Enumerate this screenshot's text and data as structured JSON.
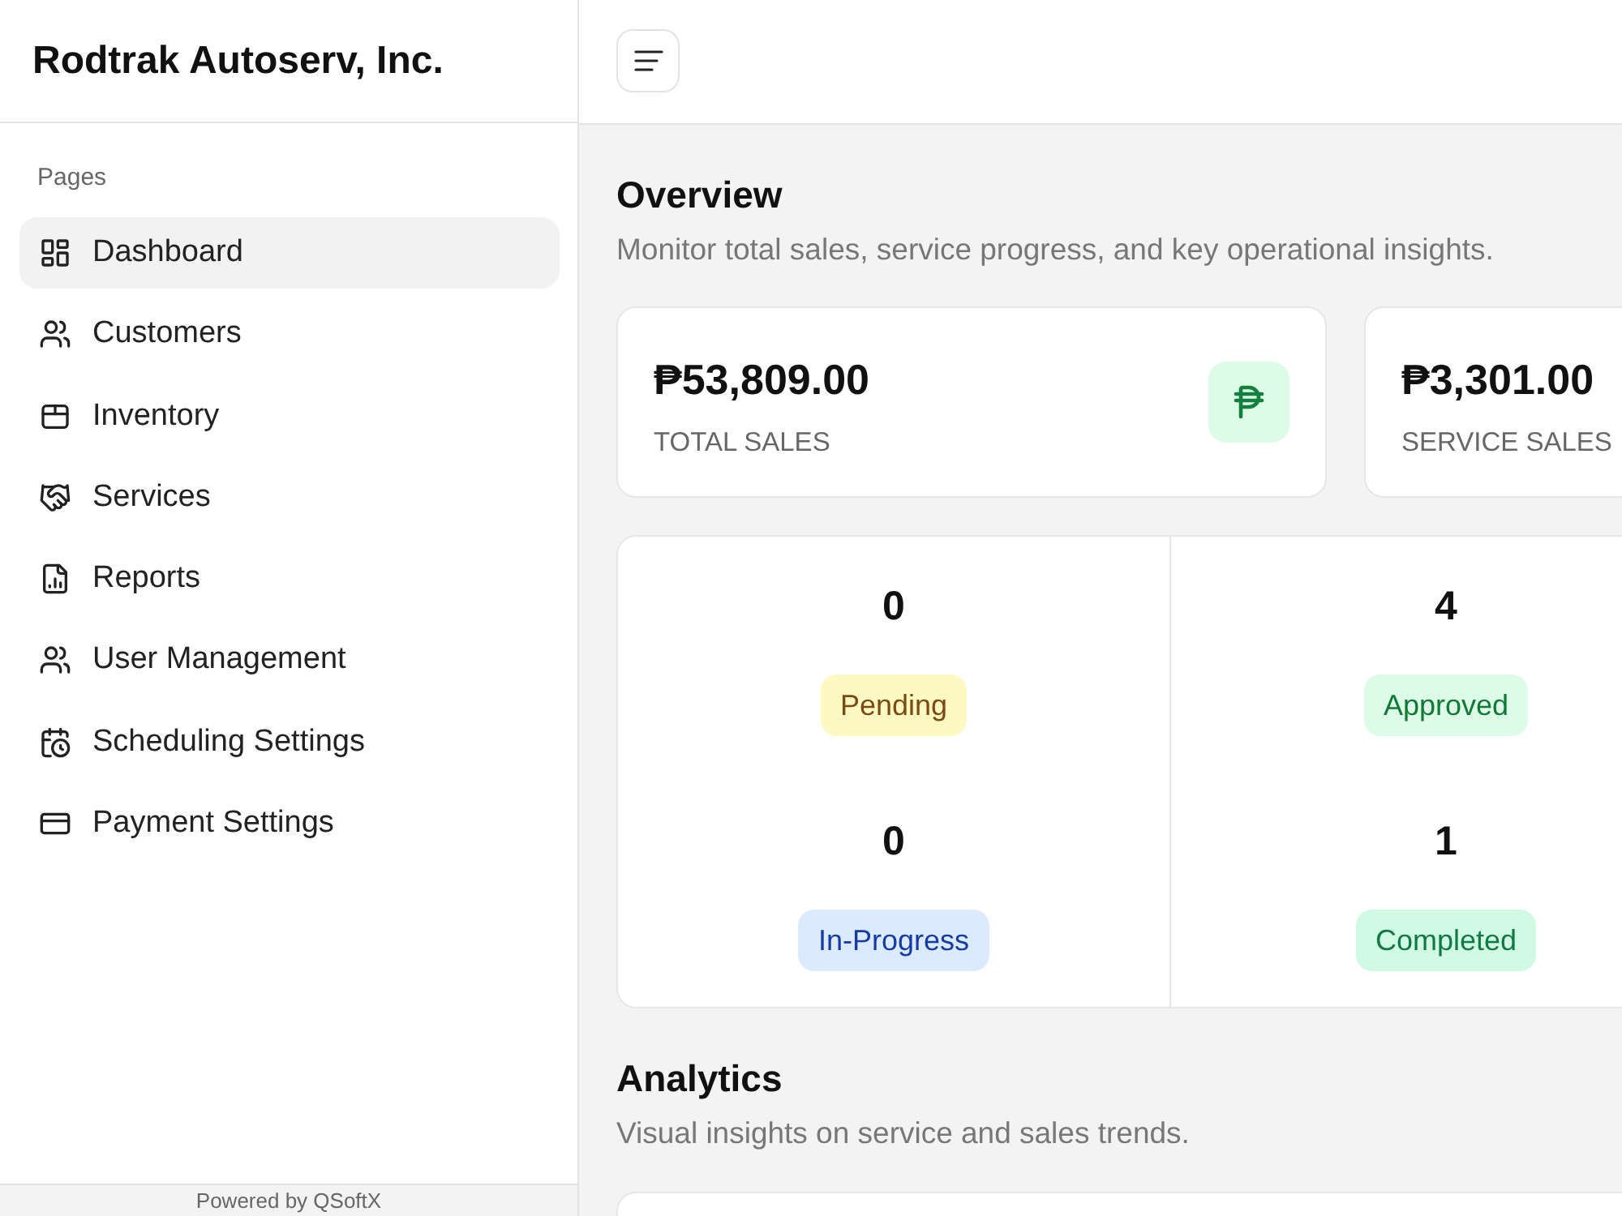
{
  "sidebar": {
    "title": "Rodtrak Autoserv, Inc.",
    "section_label": "Pages",
    "items": [
      {
        "label": "Dashboard",
        "selected": true
      },
      {
        "label": "Customers",
        "selected": false
      },
      {
        "label": "Inventory",
        "selected": false
      },
      {
        "label": "Services",
        "selected": false
      },
      {
        "label": "Reports",
        "selected": false
      },
      {
        "label": "User Management",
        "selected": false
      },
      {
        "label": "Scheduling Settings",
        "selected": false
      },
      {
        "label": "Payment Settings",
        "selected": false
      }
    ],
    "footer": "Powered by QSoftX"
  },
  "overview": {
    "title": "Overview",
    "subtitle": "Monitor total sales, service progress, and key operational insights.",
    "cards": [
      {
        "value": "₱53,809.00",
        "label": "TOTAL SALES",
        "icon": true
      },
      {
        "value": "₱3,301.00",
        "label": "SERVICE SALES"
      }
    ],
    "statuses": [
      {
        "count": "0",
        "label": "Pending",
        "color": "#fef9c3"
      },
      {
        "count": "4",
        "label": "Approved",
        "color": "#dcfce7"
      },
      {
        "count": "0",
        "label": "In-Progress",
        "color": "#dbeafe"
      },
      {
        "count": "1",
        "label": "Completed",
        "color": "#d1fae5"
      }
    ]
  },
  "analytics": {
    "title": "Analytics",
    "subtitle": "Visual insights on service and sales trends."
  }
}
